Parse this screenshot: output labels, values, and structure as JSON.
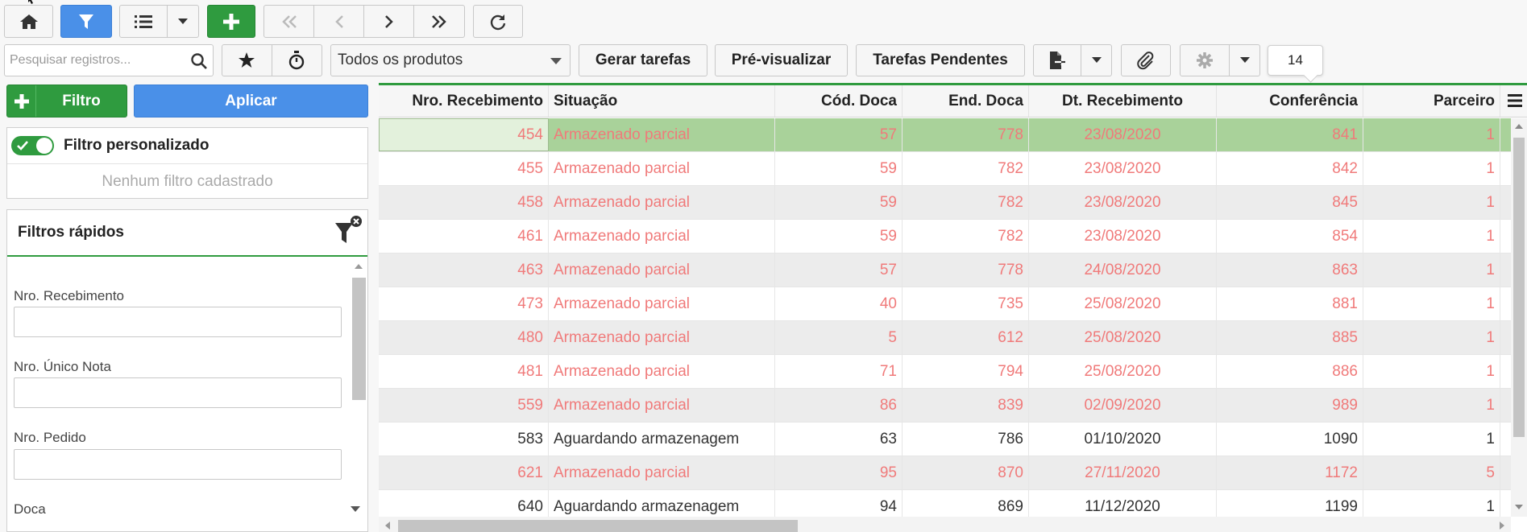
{
  "toolbar": {
    "search_placeholder": "Pesquisar registros...",
    "product_select": "Todos os produtos",
    "gerar_tarefas": "Gerar tarefas",
    "pre_visualizar": "Pré-visualizar",
    "tarefas_pendentes": "Tarefas Pendentes",
    "badge_count": "14"
  },
  "left": {
    "filtro_btn": "Filtro",
    "aplicar_btn": "Aplicar",
    "filtro_personalizado": "Filtro personalizado",
    "nenhum_filtro": "Nenhum filtro cadastrado",
    "filtros_rapidos": "Filtros rápidos",
    "fields": [
      "Nro. Recebimento",
      "Nro. Único Nota",
      "Nro. Pedido",
      "Doca"
    ]
  },
  "grid": {
    "columns": [
      "Nro. Recebimento",
      "Situação",
      "Cód. Doca",
      "End. Doca",
      "Dt. Recebimento",
      "Conferência",
      "Parceiro"
    ],
    "rows": [
      {
        "nro": "454",
        "situacao": "Armazenado parcial",
        "cod": "57",
        "end": "778",
        "dt": "23/08/2020",
        "conf": "841",
        "parc": "1",
        "style": "red",
        "selected": true
      },
      {
        "nro": "455",
        "situacao": "Armazenado parcial",
        "cod": "59",
        "end": "782",
        "dt": "23/08/2020",
        "conf": "842",
        "parc": "1",
        "style": "red"
      },
      {
        "nro": "458",
        "situacao": "Armazenado parcial",
        "cod": "59",
        "end": "782",
        "dt": "23/08/2020",
        "conf": "845",
        "parc": "1",
        "style": "red"
      },
      {
        "nro": "461",
        "situacao": "Armazenado parcial",
        "cod": "59",
        "end": "782",
        "dt": "23/08/2020",
        "conf": "854",
        "parc": "1",
        "style": "red"
      },
      {
        "nro": "463",
        "situacao": "Armazenado parcial",
        "cod": "57",
        "end": "778",
        "dt": "24/08/2020",
        "conf": "863",
        "parc": "1",
        "style": "red"
      },
      {
        "nro": "473",
        "situacao": "Armazenado parcial",
        "cod": "40",
        "end": "735",
        "dt": "25/08/2020",
        "conf": "881",
        "parc": "1",
        "style": "red"
      },
      {
        "nro": "480",
        "situacao": "Armazenado parcial",
        "cod": "5",
        "end": "612",
        "dt": "25/08/2020",
        "conf": "885",
        "parc": "1",
        "style": "red"
      },
      {
        "nro": "481",
        "situacao": "Armazenado parcial",
        "cod": "71",
        "end": "794",
        "dt": "25/08/2020",
        "conf": "886",
        "parc": "1",
        "style": "red"
      },
      {
        "nro": "559",
        "situacao": "Armazenado parcial",
        "cod": "86",
        "end": "839",
        "dt": "02/09/2020",
        "conf": "989",
        "parc": "1",
        "style": "red"
      },
      {
        "nro": "583",
        "situacao": "Aguardando armazenagem",
        "cod": "63",
        "end": "786",
        "dt": "01/10/2020",
        "conf": "1090",
        "parc": "1",
        "style": "dark"
      },
      {
        "nro": "621",
        "situacao": "Armazenado parcial",
        "cod": "95",
        "end": "870",
        "dt": "27/11/2020",
        "conf": "1172",
        "parc": "5",
        "style": "red"
      },
      {
        "nro": "640",
        "situacao": "Aguardando armazenagem",
        "cod": "94",
        "end": "869",
        "dt": "11/12/2020",
        "conf": "1199",
        "parc": "1",
        "style": "dark"
      }
    ]
  },
  "colors": {
    "green": "#2f9b3f",
    "blue": "#4a90e8",
    "row_red_text": "#f07a7a",
    "selected_row": "#a9d29a"
  }
}
